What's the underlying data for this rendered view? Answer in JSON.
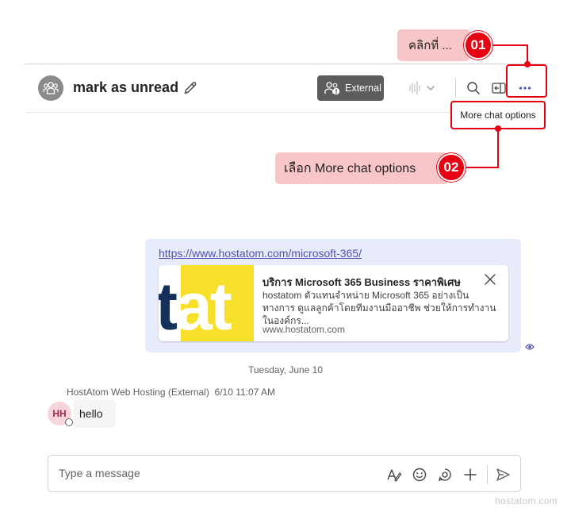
{
  "header": {
    "chat_title": "mark as unread",
    "external_badge": "External",
    "more_options_tooltip": "More chat options"
  },
  "annotations": {
    "step1": {
      "number": "01",
      "text": "คลิกที่ ..."
    },
    "step2": {
      "number": "02",
      "text": "เลือก More chat options"
    }
  },
  "message": {
    "link": "https://www.hostatom.com/microsoft-365/",
    "preview": {
      "thumb_text_a": "t",
      "thumb_text_b": "at",
      "title": "บริการ Microsoft 365 Business ราคาพิเศษ",
      "description": "hostatom ตัวแทนจำหน่าย Microsoft 365 อย่างเป็นทางการ ดูแลลูกค้าโดยทีมงานมืออาชีพ ช่วยให้การทำงานในองค์กร...",
      "domain": "www.hostatom.com"
    }
  },
  "date_separator": "Tuesday, June 10",
  "reply": {
    "sender": "HostAtom Web Hosting (External)",
    "time": "6/10 11:07 AM",
    "avatar_initials": "HH",
    "text": "hello"
  },
  "compose": {
    "placeholder": "Type a message"
  },
  "watermark": "hostatom.com",
  "colors": {
    "annotation_red": "#e60012",
    "callout_pink": "#f8c6c9",
    "bubble_bg": "#e8ebfa",
    "accent": "#4f52b2"
  }
}
